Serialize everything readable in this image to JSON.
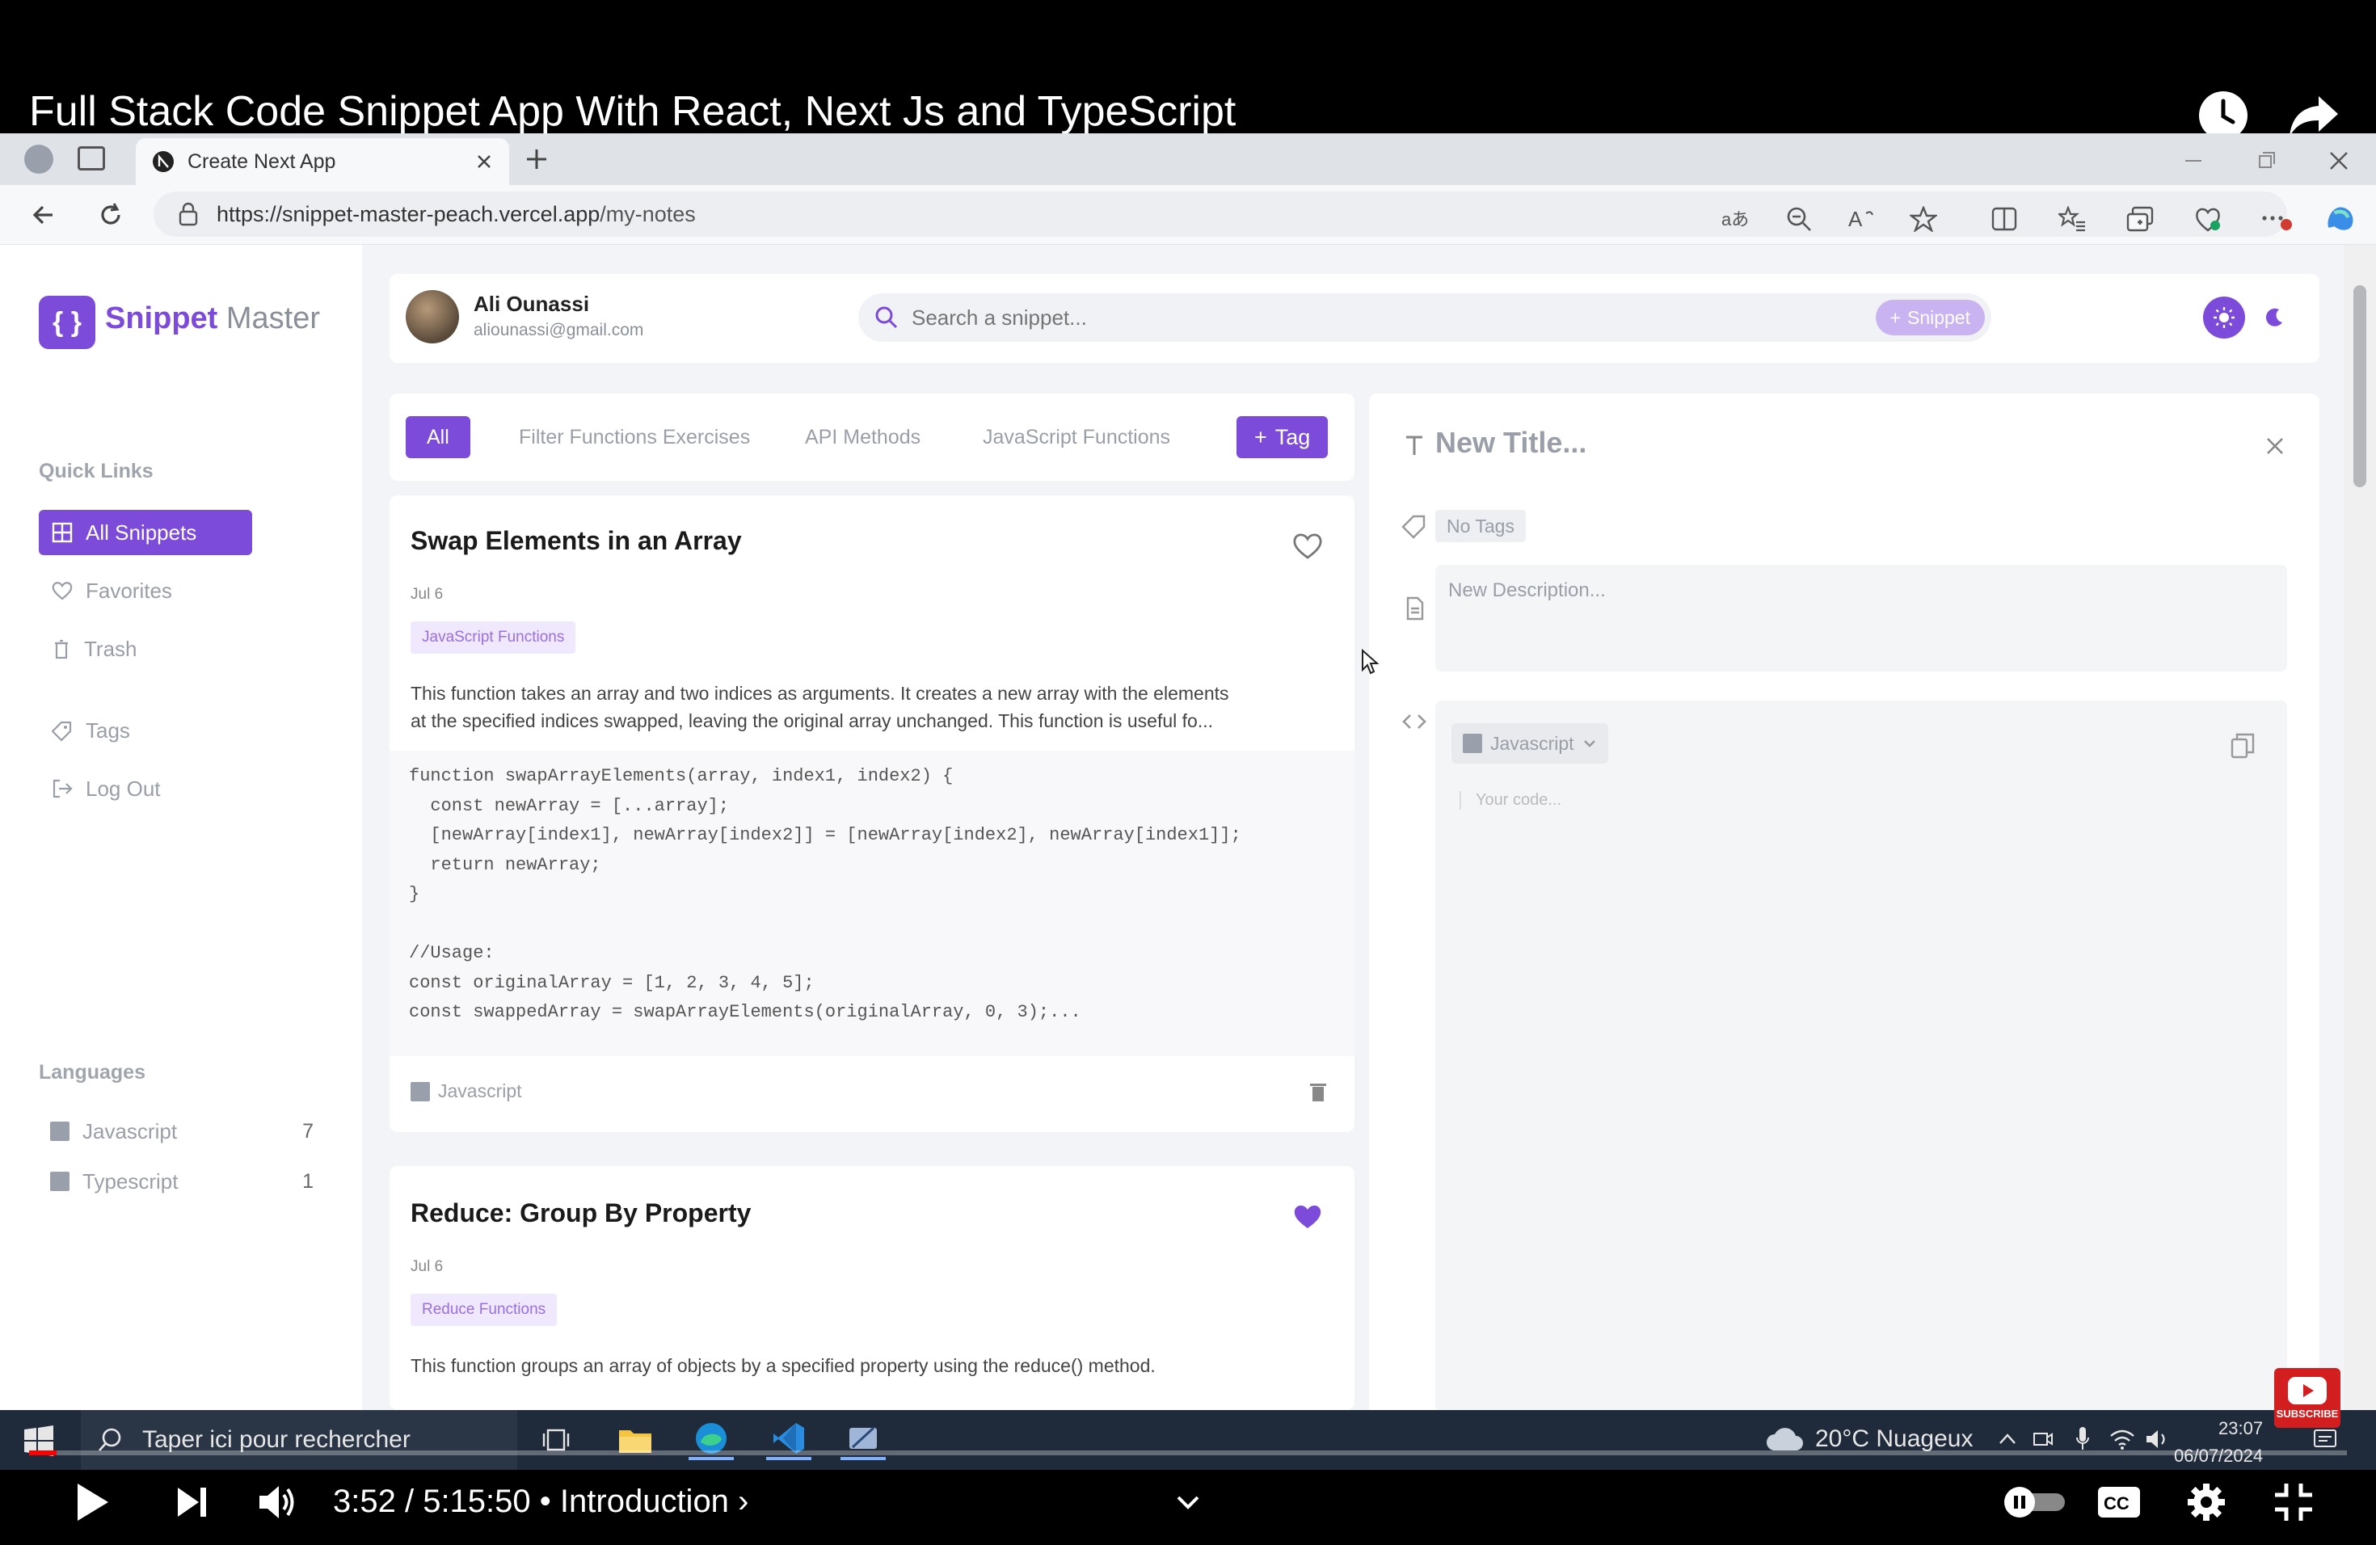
{
  "video": {
    "title": "Full Stack Code Snippet App With React, Next Js and TypeScript",
    "time": "3:52 / 5:15:50",
    "chapter": "Introduction",
    "progress_fraction": 0.012,
    "subscribe_label": "SUBSCRIBE"
  },
  "browser": {
    "tab_title": "Create Next App",
    "url_host": "https://snippet-master-peach.vercel.app",
    "url_path": "/my-notes"
  },
  "app": {
    "logo_primary": "Snippet",
    "logo_secondary": "Master",
    "quick_links_label": "Quick Links",
    "quick_links": [
      {
        "label": "All Snippets",
        "icon": "grid-icon"
      },
      {
        "label": "Favorites",
        "icon": "heart-icon"
      },
      {
        "label": "Trash",
        "icon": "trash-icon"
      },
      {
        "label": "Tags",
        "icon": "tag-icon"
      },
      {
        "label": "Log Out",
        "icon": "logout-icon"
      }
    ],
    "languages_label": "Languages",
    "languages": [
      {
        "label": "Javascript",
        "count": "7"
      },
      {
        "label": "Typescript",
        "count": "1"
      }
    ],
    "user": {
      "name": "Ali Ounassi",
      "email": "aliounassi@gmail.com"
    },
    "search_placeholder": "Search a snippet...",
    "snippet_button": "Snippet",
    "tags": [
      "All",
      "Filter Functions Exercises",
      "API Methods",
      "JavaScript Functions"
    ],
    "add_tag_label": "Tag",
    "accent_color": "#7c4bd9"
  },
  "cards": [
    {
      "title": "Swap Elements in an Array",
      "date": "Jul 6",
      "tag": "JavaScript Functions",
      "desc_line1": "This function takes an array and two indices as arguments. It creates a new array with the elements",
      "desc_line2": "at the specified indices swapped, leaving the original array unchanged. This function is useful fo...",
      "code": "function swapArrayElements(array, index1, index2) {\n  const newArray = [...array];\n  [newArray[index1], newArray[index2]] = [newArray[index2], newArray[index1]];\n  return newArray;\n}\n\n//Usage:\nconst originalArray = [1, 2, 3, 4, 5];\nconst swappedArray = swapArrayElements(originalArray, 0, 3);...",
      "language": "Javascript",
      "favorite": false
    },
    {
      "title": "Reduce: Group By Property",
      "date": "Jul 6",
      "tag": "Reduce Functions",
      "desc_line1": "This function groups an array of objects by a specified property using the reduce() method.",
      "favorite": true
    }
  ],
  "editor": {
    "title_placeholder": "New Title...",
    "no_tags": "No Tags",
    "desc_placeholder": "New Description...",
    "language": "Javascript",
    "code_placeholder": "Your code..."
  },
  "taskbar": {
    "search_placeholder": "Taper ici pour rechercher",
    "weather": "20°C  Nuageux",
    "time": "23:07",
    "date": "06/07/2024"
  }
}
